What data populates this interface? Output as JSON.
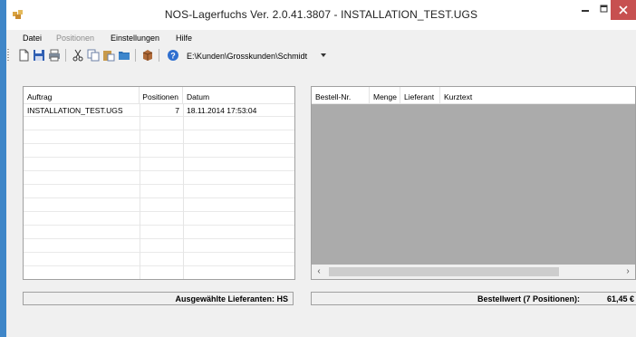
{
  "window": {
    "title": "NOS-Lagerfuchs Ver. 2.0.41.3807 - INSTALLATION_TEST.UGS"
  },
  "menu": [
    {
      "label": "Datei",
      "enabled": true
    },
    {
      "label": "Positionen",
      "enabled": false
    },
    {
      "label": "Einstellungen",
      "enabled": true
    },
    {
      "label": "Hilfe",
      "enabled": true
    }
  ],
  "toolbar": {
    "buttons": [
      "new-document-icon",
      "save-icon",
      "print-icon",
      "cut-icon",
      "copy-icon",
      "paste-icon",
      "open-folder-icon",
      "package-icon",
      "help-icon"
    ],
    "path": "E:\\Kunden\\Grosskunden\\Schmidt"
  },
  "orders": {
    "columns": [
      "Auftrag",
      "Positionen",
      "Datum"
    ],
    "rows": [
      {
        "auftrag": "INSTALLATION_TEST.UGS",
        "positionen": "7",
        "datum": "18.11.2014 17:53:04"
      }
    ]
  },
  "positions": {
    "columns": [
      "Bestell-Nr.",
      "Menge",
      "Lieferant",
      "Kurztext"
    ]
  },
  "status": {
    "lieferanten": "Ausgewählte Lieferanten: HS",
    "bestellwert_label": "Bestellwert (7 Positionen):",
    "bestellwert_value": "61,45 €"
  },
  "colors": {
    "accent": "#3f86c8",
    "close_button": "#c75050",
    "panel_empty": "#ababab"
  }
}
